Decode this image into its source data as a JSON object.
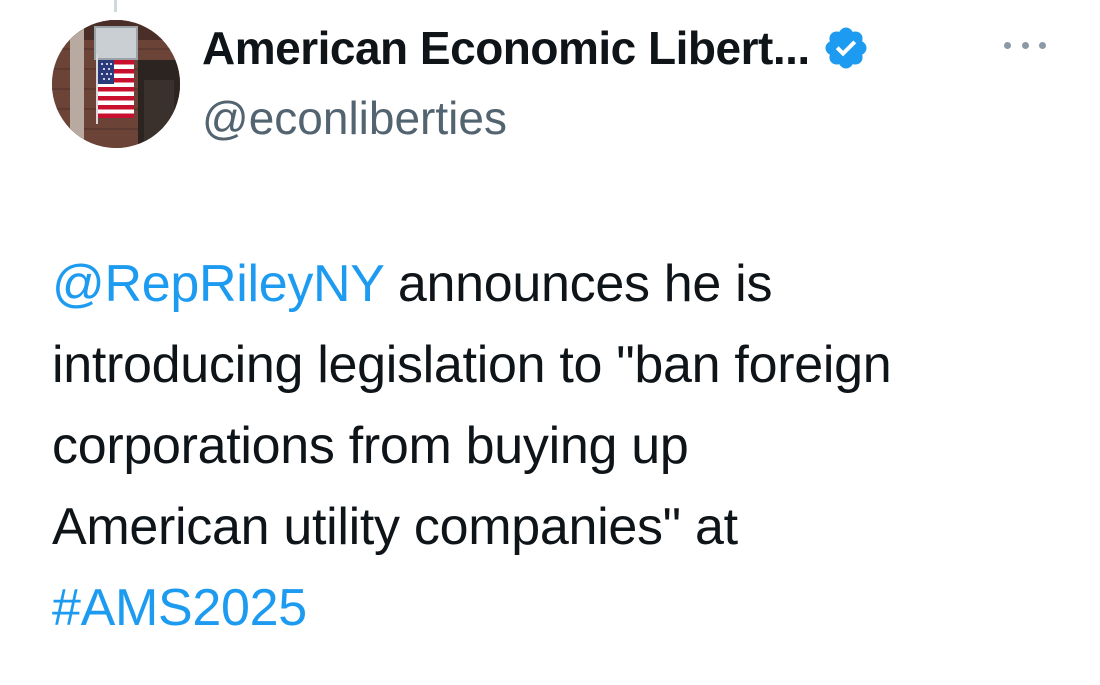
{
  "author": {
    "display_name": "American Economic Libert...",
    "handle": "@econliberties",
    "verified": true,
    "avatar_icon": "avatar-us-flag-building",
    "more_icon": "more-options-icon"
  },
  "tweet": {
    "mention": "@RepRileyNY",
    "line1_rest": " announces he is",
    "line2": "introducing legislation to \"ban foreign",
    "line3": "corporations from buying up",
    "line4": "American utility companies\" at",
    "hashtag": "#AMS2025"
  },
  "colors": {
    "text": "#0f1419",
    "secondary": "#536471",
    "link": "#1d9bf0",
    "verified_badge": "#1d9bf0"
  }
}
